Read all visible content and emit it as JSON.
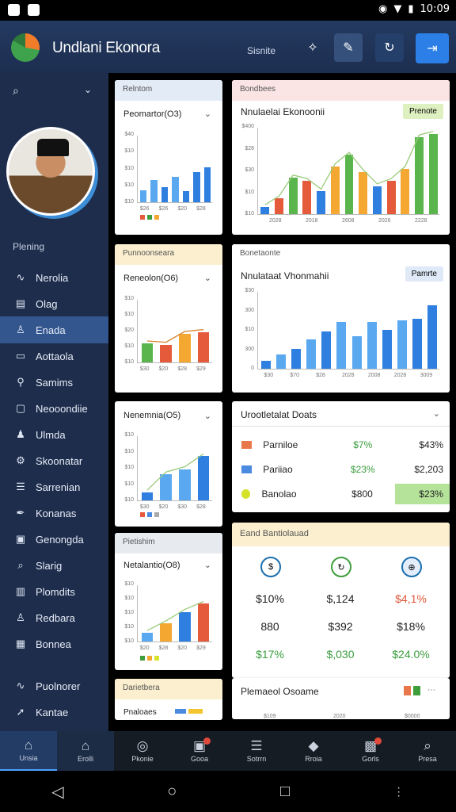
{
  "status": {
    "time": "10:09"
  },
  "header": {
    "title": "Undlani Ekonora",
    "link": "Sisnite"
  },
  "sidebar": {
    "section": "Plening",
    "items": [
      {
        "label": "Nerolia",
        "icon": "wave-icon"
      },
      {
        "label": "Olag",
        "icon": "doc-icon"
      },
      {
        "label": "Enada",
        "icon": "user-icon"
      },
      {
        "label": "Aottaola",
        "icon": "card-icon"
      },
      {
        "label": "Samims",
        "icon": "pin-icon"
      },
      {
        "label": "Neooondiie",
        "icon": "chat-icon"
      },
      {
        "label": "Ulmda",
        "icon": "person-icon"
      },
      {
        "label": "Skoonatar",
        "icon": "gear-icon"
      },
      {
        "label": "Sarrenian",
        "icon": "list-icon"
      },
      {
        "label": "Konanas",
        "icon": "feather-icon"
      },
      {
        "label": "Genongda",
        "icon": "box-icon"
      },
      {
        "label": "Slarig",
        "icon": "search-icon"
      },
      {
        "label": "Plomdits",
        "icon": "chart-icon"
      },
      {
        "label": "Redbara",
        "icon": "user-icon"
      },
      {
        "label": "Bonnea",
        "icon": "book-icon"
      },
      {
        "label": "Puolnorer",
        "icon": "wave-icon"
      },
      {
        "label": "Kantae",
        "icon": "send-icon"
      }
    ]
  },
  "cards": {
    "c1": {
      "header": "Relntom",
      "title": "Peomartor(O3)",
      "yticks": [
        "$40",
        "$10",
        "$10",
        "$10",
        "$10"
      ],
      "xticks": [
        "$26",
        "$26",
        "$20",
        "$28"
      ],
      "values": [
        18,
        33,
        22,
        38,
        17,
        45,
        52
      ]
    },
    "c2": {
      "header": "Bondbees",
      "title": "Nnulaelai Ekonoonii",
      "tag": "Prenote",
      "yticks": [
        "$400",
        "$28",
        "$30",
        "$10",
        "$10"
      ],
      "xticks": [
        "2028",
        "2018",
        "2608",
        "2026",
        "2228"
      ],
      "values": [
        8,
        18,
        42,
        38,
        26,
        55,
        68,
        48,
        32,
        38,
        52,
        88,
        92
      ]
    },
    "c3": {
      "header": "Punnoonseara",
      "title": "Reneolon(O6)",
      "yticks": [
        "$10",
        "$10",
        "$20",
        "$10",
        "$10"
      ],
      "xticks": [
        "$30",
        "$20",
        "$28",
        "$29"
      ],
      "values": [
        30,
        28,
        45,
        48
      ]
    },
    "c4": {
      "header": "Bonetaonte",
      "title": "Nnulataat Vhonmahii",
      "tag": "Pamrte",
      "yticks": [
        "$30",
        "300",
        "$10",
        "300",
        "0"
      ],
      "xticks": [
        "$30",
        "$70",
        "$28",
        "2028",
        "2008",
        "2028",
        "3009"
      ],
      "values": [
        10,
        18,
        26,
        38,
        48,
        60,
        42,
        60,
        50,
        62,
        64,
        82
      ]
    },
    "c5": {
      "title": "Nenemnia(O5)",
      "yticks": [
        "$10",
        "$10",
        "$10",
        "$10",
        "$10"
      ],
      "xticks": [
        "$30",
        "$20",
        "$30",
        "$28"
      ],
      "values": [
        12,
        40,
        48,
        68
      ]
    },
    "c6": {
      "header": "Pietishim",
      "title": "Netalantio(O8)",
      "yticks": [
        "$10",
        "$10",
        "$10",
        "$10",
        "$10"
      ],
      "xticks": [
        "$20",
        "$28",
        "$20",
        "$29"
      ],
      "values": [
        15,
        32,
        52,
        66
      ]
    },
    "c7": {
      "header": "Darietbera",
      "title": "Pnaloaes"
    },
    "deals": {
      "title": "Urootletalat Doats",
      "rows": [
        {
          "name": "Parniloe",
          "pct": "$7%",
          "val": "$43%",
          "color": "#e8784a"
        },
        {
          "name": "Pariiao",
          "pct": "$23%",
          "val": "$2,203",
          "color": "#4a8be0"
        },
        {
          "name": "Banolao",
          "pct": "$800",
          "val": "$23%",
          "color": "#d6e22a"
        }
      ]
    },
    "stats": {
      "title": "Eand Bantiolauad",
      "row1": [
        "$10%",
        "$,124",
        "$4,1%"
      ],
      "row2": [
        "880",
        "$392",
        "$18%"
      ],
      "row3": [
        "$17%",
        "$,030",
        "$24.0%"
      ]
    },
    "bottom": {
      "title": "Plemaeol Osoame",
      "ticks": [
        "$109",
        "2020",
        "$0000"
      ]
    }
  },
  "tabs": [
    {
      "label": "Unsia",
      "icon": "home-icon"
    },
    {
      "label": "Erolli",
      "icon": "home-icon"
    },
    {
      "label": "Pkonie",
      "icon": "globe-icon"
    },
    {
      "label": "Gooa",
      "icon": "box-icon"
    },
    {
      "label": "Sotrrn",
      "icon": "list-icon"
    },
    {
      "label": "Rroia",
      "icon": "shield-icon"
    },
    {
      "label": "Gorls",
      "icon": "inbox-icon"
    },
    {
      "label": "Presa",
      "icon": "search-icon"
    }
  ],
  "colors": {
    "blue": "#2f7fe0",
    "lightblue": "#5aa9f0",
    "orange": "#f4a731",
    "red": "#e45a3a",
    "green": "#5ab54c",
    "darkgreen": "#3f9e3c"
  }
}
